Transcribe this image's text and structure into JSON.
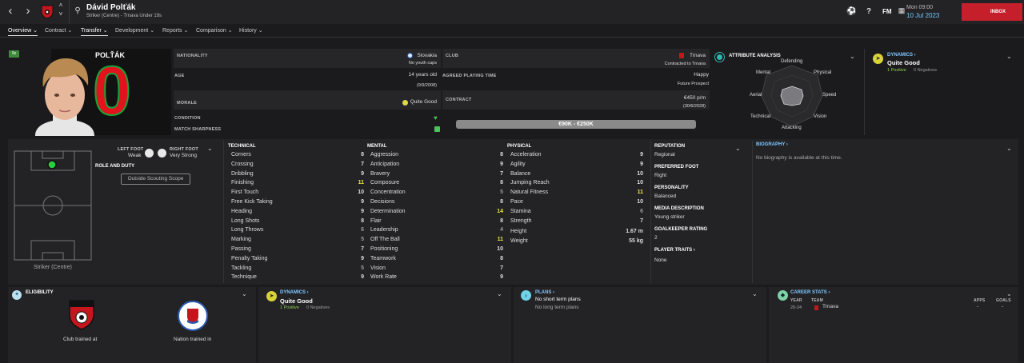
{
  "header": {
    "name": "Dávid Polťák",
    "subtitle": "Striker (Centre) - Trnava Under 19s",
    "fm": "FM",
    "day": "Mon 09:00",
    "date": "10 Jul 2023",
    "inbox": "INBOX"
  },
  "tabs": [
    "Overview",
    "Contract",
    "Transfer",
    "Development",
    "Reports",
    "Comparison",
    "History"
  ],
  "profile": {
    "badge": "9s",
    "shirt_name": "POLŤÁK",
    "shirt_number": "0",
    "nationality_label": "NATIONALITY",
    "nationality": "Slovakia",
    "youth_caps": "No youth caps",
    "age_label": "AGE",
    "age": "14 years old",
    "dob": "(9/9/2008)",
    "morale_label": "MORALE",
    "morale": "Quite Good",
    "condition_label": "CONDITION",
    "sharpness_label": "MATCH SHARPNESS",
    "club_label": "CLUB",
    "club": "Trnava",
    "contracted": "Contracted to Trnava",
    "playing_time_label": "AGREED PLAYING TIME",
    "playing_time": "Happy",
    "prospect": "Future Prospect",
    "contract_label": "CONTRACT",
    "wage": "€450 p/m",
    "contract_end": "(30/6/2028)",
    "value": "€90K - €250K"
  },
  "attribute_analysis": {
    "title": "ATTRIBUTE ANALYSIS",
    "labels": [
      "Defending",
      "Physical",
      "Speed",
      "Vision",
      "Attacking",
      "Technical",
      "Aerial",
      "Mental"
    ]
  },
  "dynamics_top": {
    "title": "DYNAMICS",
    "status": "Quite Good",
    "positive": "1 Positive",
    "negatives": "0 Negatives"
  },
  "pitch": {
    "left_foot_label": "LEFT FOOT",
    "left_foot": "Weak",
    "right_foot_label": "RIGHT FOOT",
    "right_foot": "Very Strong",
    "role_label": "ROLE AND DUTY",
    "scouting": "Outside Scouting Scope",
    "position": "Striker (Centre)"
  },
  "technical": {
    "title": "TECHNICAL",
    "rows": [
      {
        "n": "Corners",
        "v": "8"
      },
      {
        "n": "Crossing",
        "v": "7"
      },
      {
        "n": "Dribbling",
        "v": "9"
      },
      {
        "n": "Finishing",
        "v": "11"
      },
      {
        "n": "First Touch",
        "v": "10"
      },
      {
        "n": "Free Kick Taking",
        "v": "9"
      },
      {
        "n": "Heading",
        "v": "9"
      },
      {
        "n": "Long Shots",
        "v": "8"
      },
      {
        "n": "Long Throws",
        "v": "6"
      },
      {
        "n": "Marking",
        "v": "5"
      },
      {
        "n": "Passing",
        "v": "7"
      },
      {
        "n": "Penalty Taking",
        "v": "9"
      },
      {
        "n": "Tackling",
        "v": "5"
      },
      {
        "n": "Technique",
        "v": "9"
      }
    ]
  },
  "mental": {
    "title": "MENTAL",
    "rows": [
      {
        "n": "Aggression",
        "v": "8"
      },
      {
        "n": "Anticipation",
        "v": "9"
      },
      {
        "n": "Bravery",
        "v": "7"
      },
      {
        "n": "Composure",
        "v": "8"
      },
      {
        "n": "Concentration",
        "v": "5"
      },
      {
        "n": "Decisions",
        "v": "8"
      },
      {
        "n": "Determination",
        "v": "14"
      },
      {
        "n": "Flair",
        "v": "8"
      },
      {
        "n": "Leadership",
        "v": "4"
      },
      {
        "n": "Off The Ball",
        "v": "11"
      },
      {
        "n": "Positioning",
        "v": "10"
      },
      {
        "n": "Teamwork",
        "v": "8"
      },
      {
        "n": "Vision",
        "v": "7"
      },
      {
        "n": "Work Rate",
        "v": "9"
      }
    ]
  },
  "physical": {
    "title": "PHYSICAL",
    "rows": [
      {
        "n": "Acceleration",
        "v": "9"
      },
      {
        "n": "Agility",
        "v": "9"
      },
      {
        "n": "Balance",
        "v": "10"
      },
      {
        "n": "Jumping Reach",
        "v": "10"
      },
      {
        "n": "Natural Fitness",
        "v": "11"
      },
      {
        "n": "Pace",
        "v": "10"
      },
      {
        "n": "Stamina",
        "v": "6"
      },
      {
        "n": "Strength",
        "v": "7"
      }
    ],
    "height_label": "Height",
    "height": "1.67 m",
    "weight_label": "Weight",
    "weight": "55 kg"
  },
  "info": {
    "reputation_label": "REPUTATION",
    "reputation": "Regional",
    "foot_label": "PREFERRED FOOT",
    "foot": "Right",
    "personality_label": "PERSONALITY",
    "personality": "Balanced",
    "media_label": "MEDIA DESCRIPTION",
    "media": "Young striker",
    "gk_label": "GOALKEEPER RATING",
    "gk": "2",
    "traits_label": "PLAYER TRAITS",
    "traits": "None"
  },
  "biography": {
    "title": "BIOGRAPHY",
    "text": "No biography is available at this time."
  },
  "eligibility": {
    "title": "ELIGIBILITY",
    "club": "Club trained at",
    "nation": "Nation trained in"
  },
  "dynamics_bottom": {
    "title": "DYNAMICS",
    "status": "Quite Good",
    "positive": "1 Positive",
    "negatives": "0 Negatives"
  },
  "plans": {
    "title": "PLANS",
    "short": "No short term plans",
    "long": "No long term plans"
  },
  "career": {
    "title": "CAREER STATS",
    "year_label": "YEAR",
    "team_label": "TEAM",
    "apps_label": "APPS",
    "goals_label": "GOALS",
    "year": "20-24",
    "team": "Trnava",
    "apps": "-",
    "goals": "-"
  }
}
